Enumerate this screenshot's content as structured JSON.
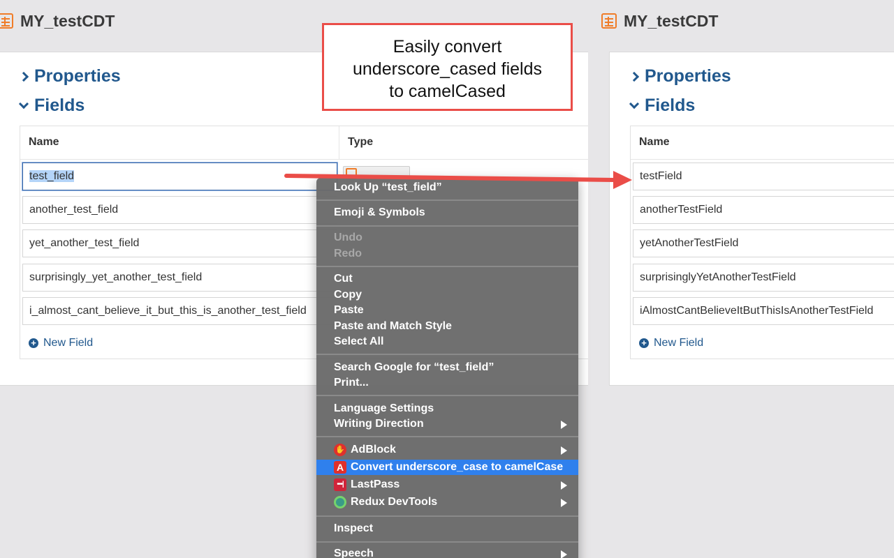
{
  "left_pane": {
    "title": "MY_testCDT",
    "properties_label": "Properties",
    "fields_label": "Fields",
    "col_name": "Name",
    "col_type": "Type",
    "fields": [
      "test_field",
      "another_test_field",
      "yet_another_test_field",
      "surprisingly_yet_another_test_field",
      "i_almost_cant_believe_it_but_this_is_another_test_field"
    ],
    "new_field_label": "New Field"
  },
  "right_pane": {
    "title": "MY_testCDT",
    "properties_label": "Properties",
    "fields_label": "Fields",
    "col_name": "Name",
    "fields": [
      "testField",
      "anotherTestField",
      "yetAnotherTestField",
      "surprisinglyYetAnotherTestField",
      "iAlmostCantBelieveItButThisIsAnotherTestField"
    ],
    "new_field_label": "New Field"
  },
  "callout": {
    "line1": "Easily convert",
    "line2": "underscore_cased fields",
    "line3": "to camelCased"
  },
  "context_menu": {
    "look_up": "Look Up “test_field”",
    "emoji": "Emoji & Symbols",
    "undo": "Undo",
    "redo": "Redo",
    "cut": "Cut",
    "copy": "Copy",
    "paste": "Paste",
    "paste_match": "Paste and Match Style",
    "select_all": "Select All",
    "search_google": "Search Google for “test_field”",
    "print": "Print...",
    "language_settings": "Language Settings",
    "writing_direction": "Writing Direction",
    "adblock": "AdBlock",
    "convert": "Convert underscore_case to camelCase",
    "lastpass": "LastPass",
    "redux": "Redux DevTools",
    "inspect": "Inspect",
    "speech": "Speech"
  },
  "colors": {
    "accent_blue": "#21588d",
    "cdt_orange": "#f07c28",
    "callout_red": "#ea4d48",
    "menu_highlight": "#2f80ed"
  }
}
